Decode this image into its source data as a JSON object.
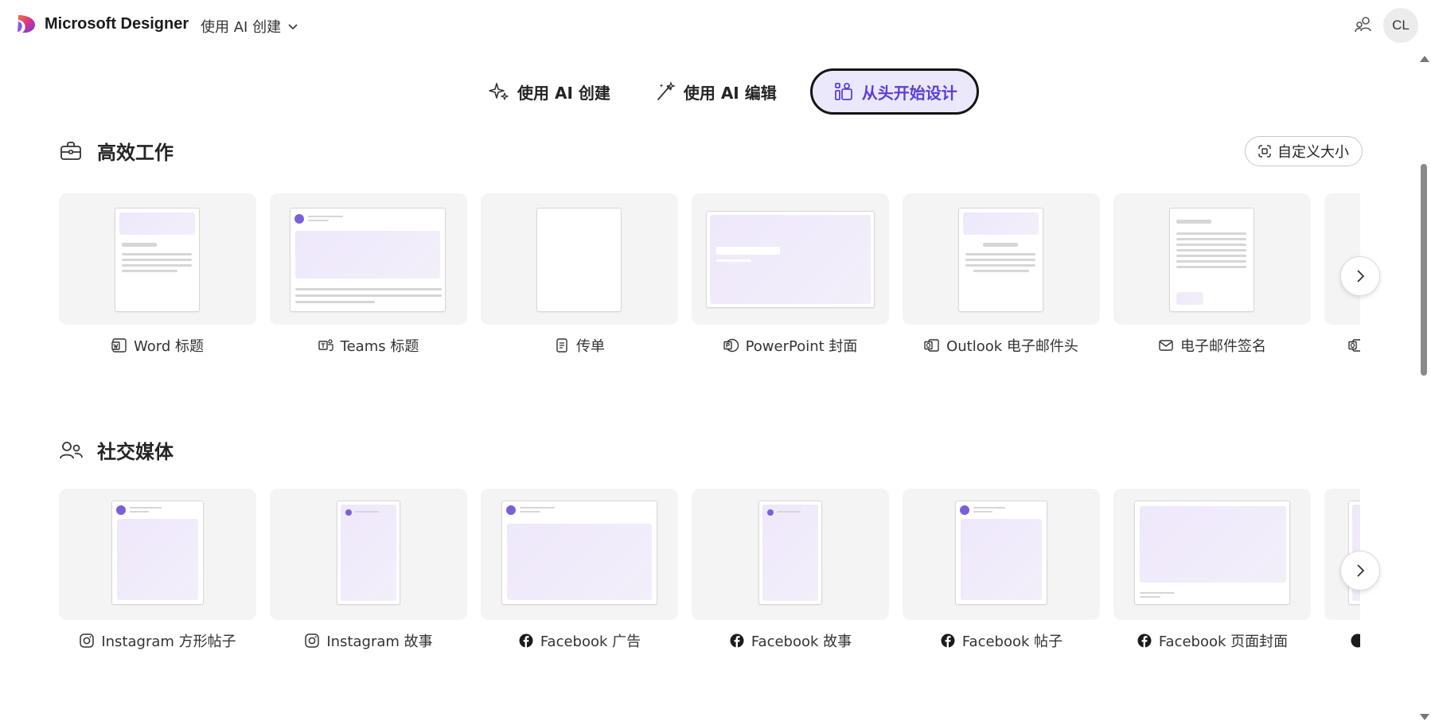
{
  "header": {
    "app_title": "Microsoft Designer",
    "mode_dropdown": "使用 AI 创建",
    "avatar_initials": "CL"
  },
  "tabs": [
    {
      "label": "使用 AI 创建",
      "icon": "sparkle-icon",
      "active": false
    },
    {
      "label": "使用 AI 编辑",
      "icon": "magic-wand-icon",
      "active": false
    },
    {
      "label": "从头开始设计",
      "icon": "shapes-icon",
      "active": true
    }
  ],
  "sections": {
    "productivity": {
      "title": "高效工作",
      "icon": "briefcase-icon",
      "custom_size_label": "自定义大小",
      "cards": [
        {
          "label": "Word 标题",
          "icon": "word-icon"
        },
        {
          "label": "Teams 标题",
          "icon": "teams-icon"
        },
        {
          "label": "传单",
          "icon": "document-icon"
        },
        {
          "label": "PowerPoint 封面",
          "icon": "powerpoint-icon"
        },
        {
          "label": "Outlook 电子邮件头",
          "icon": "outlook-icon"
        },
        {
          "label": "电子邮件签名",
          "icon": "mail-icon"
        }
      ]
    },
    "social": {
      "title": "社交媒体",
      "icon": "people-icon",
      "cards": [
        {
          "label": "Instagram 方形帖子",
          "icon": "instagram-icon"
        },
        {
          "label": "Instagram 故事",
          "icon": "instagram-icon"
        },
        {
          "label": "Facebook 广告",
          "icon": "facebook-icon"
        },
        {
          "label": "Facebook 故事",
          "icon": "facebook-icon"
        },
        {
          "label": "Facebook 帖子",
          "icon": "facebook-icon"
        },
        {
          "label": "Facebook 页面封面",
          "icon": "facebook-icon"
        }
      ]
    }
  },
  "colors": {
    "accent": "#5a3fd6",
    "accent_bg": "#ece8fb",
    "card_bg": "#f4f4f4"
  }
}
